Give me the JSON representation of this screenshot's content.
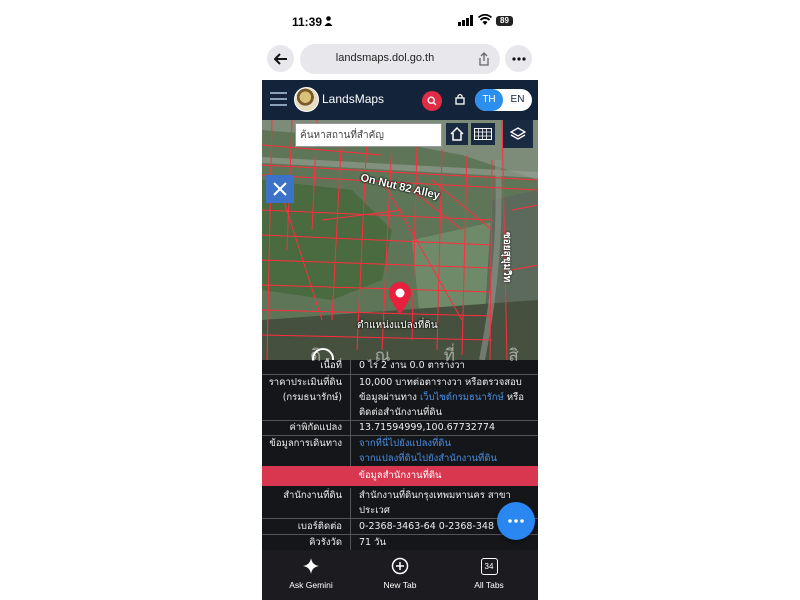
{
  "status_bar": {
    "time": "11:39",
    "battery": "89"
  },
  "browser": {
    "url": "landsmaps.dol.go.th"
  },
  "app": {
    "title": "LandsMaps",
    "lang_th": "TH",
    "lang_en": "EN",
    "colors": {
      "header": "#13233a",
      "accent_red": "#e22b44",
      "accent_blue": "#2c8ff0"
    }
  },
  "map": {
    "search_placeholder": "ค้นหาสถานที่สำคัญ",
    "clear": "×",
    "road_label": "On Nut 82 Alley",
    "road_label_vertical": "ซอยสุขุมวิท",
    "pin_label": "ตำแหน่งแปลงที่ดิน",
    "icons": [
      "home-icon",
      "grid-icon",
      "layers-icon",
      "tools-icon",
      "map-pin-icon"
    ]
  },
  "watermark": "แ ส ดิ ณ ที่ สิ (น ี)",
  "details": {
    "rows": [
      {
        "label": "เนื้อที่",
        "value": "0 ไร่ 2 งาน 0.0 ตารางวา"
      },
      {
        "label": "ราคาประเมินที่ดิน (กรมธนารักษ์)",
        "value_pre": "10,000 บาทต่อตารางวา หรือตรวจสอบข้อมูลผ่านทาง ",
        "value_link": "เว็บไซต์กรมธนารักษ์",
        "value_post": " หรือติดต่อสำนักงานที่ดิน"
      },
      {
        "label": "ค่าพิกัดแปลง",
        "value": "13.71594999,100.67732774"
      },
      {
        "label": "ข้อมูลการเดินทาง",
        "link1": "จากที่นี่ไปยังแปลงที่ดิน",
        "link2": "จากแปลงที่ดินไปยังสำนักงานที่ดิน"
      }
    ],
    "section_title": "ข้อมูลสำนักงานที่ดิน",
    "office_rows": [
      {
        "label": "สำนักงานที่ดิน",
        "value": "สำนักงานที่ดินกรุงเทพมหานคร สาขาประเวศ"
      },
      {
        "label": "เบอร์ติดต่อ",
        "value": "0-2368-3463-64 0-2368-348"
      },
      {
        "label": "คิวรังวัด",
        "value": "71 วัน"
      }
    ]
  },
  "bottom_bar": {
    "ask": "Ask Gemini",
    "new_tab": "New Tab",
    "all_tabs": "All Tabs",
    "tab_count": "34"
  }
}
